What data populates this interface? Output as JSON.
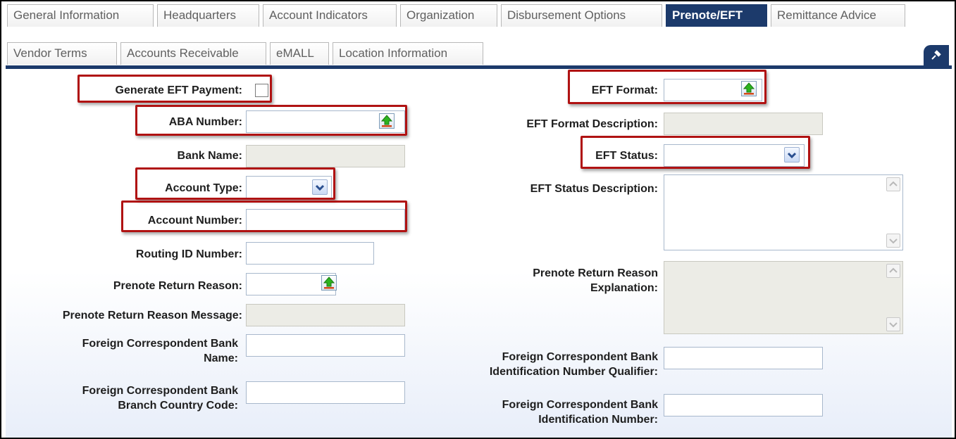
{
  "tabs_row1": [
    {
      "label": "General Information",
      "active": false
    },
    {
      "label": "Headquarters",
      "active": false
    },
    {
      "label": "Account Indicators",
      "active": false
    },
    {
      "label": "Organization",
      "active": false
    },
    {
      "label": "Disbursement Options",
      "active": false
    },
    {
      "label": "Prenote/EFT",
      "active": true
    },
    {
      "label": "Remittance Advice",
      "active": false
    }
  ],
  "tabs_row2": [
    {
      "label": "Vendor Terms",
      "active": false
    },
    {
      "label": "Accounts Receivable",
      "active": false
    },
    {
      "label": "eMALL",
      "active": false
    },
    {
      "label": "Location Information",
      "active": false
    }
  ],
  "pin_icon": "pin-icon",
  "form": {
    "generate_eft_payment": {
      "label": "Generate EFT Payment:",
      "checked": false
    },
    "aba_number": {
      "label": "ABA Number:",
      "value": ""
    },
    "bank_name": {
      "label": "Bank Name:",
      "value": ""
    },
    "account_type": {
      "label": "Account Type:",
      "value": ""
    },
    "account_number": {
      "label": "Account Number:",
      "value": ""
    },
    "routing_id_number": {
      "label": "Routing ID Number:",
      "value": ""
    },
    "prenote_return_reason": {
      "label": "Prenote Return Reason:",
      "value": ""
    },
    "prenote_return_reason_message": {
      "label": "Prenote Return Reason Message:",
      "value": ""
    },
    "fcb_name": {
      "label_line1": "Foreign Correspondent Bank",
      "label_line2": "Name:",
      "value": ""
    },
    "fcb_branch_country_code": {
      "label_line1": "Foreign Correspondent Bank",
      "label_line2": "Branch Country Code:",
      "value": ""
    },
    "eft_format": {
      "label": "EFT Format:",
      "value": ""
    },
    "eft_format_description": {
      "label": "EFT Format Description:",
      "value": ""
    },
    "eft_status": {
      "label": "EFT Status:",
      "value": ""
    },
    "eft_status_description": {
      "label": "EFT Status Description:",
      "value": ""
    },
    "prenote_return_reason_explanation": {
      "label_line1": "Prenote Return Reason",
      "label_line2": "Explanation:",
      "value": ""
    },
    "fcb_id_number_qualifier": {
      "label_line1": "Foreign Correspondent Bank",
      "label_line2": "Identification Number Qualifier:",
      "value": ""
    },
    "fcb_id_number": {
      "label_line1": "Foreign Correspondent Bank",
      "label_line2": "Identification Number:",
      "value": ""
    }
  },
  "colors": {
    "tab_active_bg": "#1c3a6b",
    "highlight": "#b01212",
    "readonly_bg": "#ecece6"
  }
}
